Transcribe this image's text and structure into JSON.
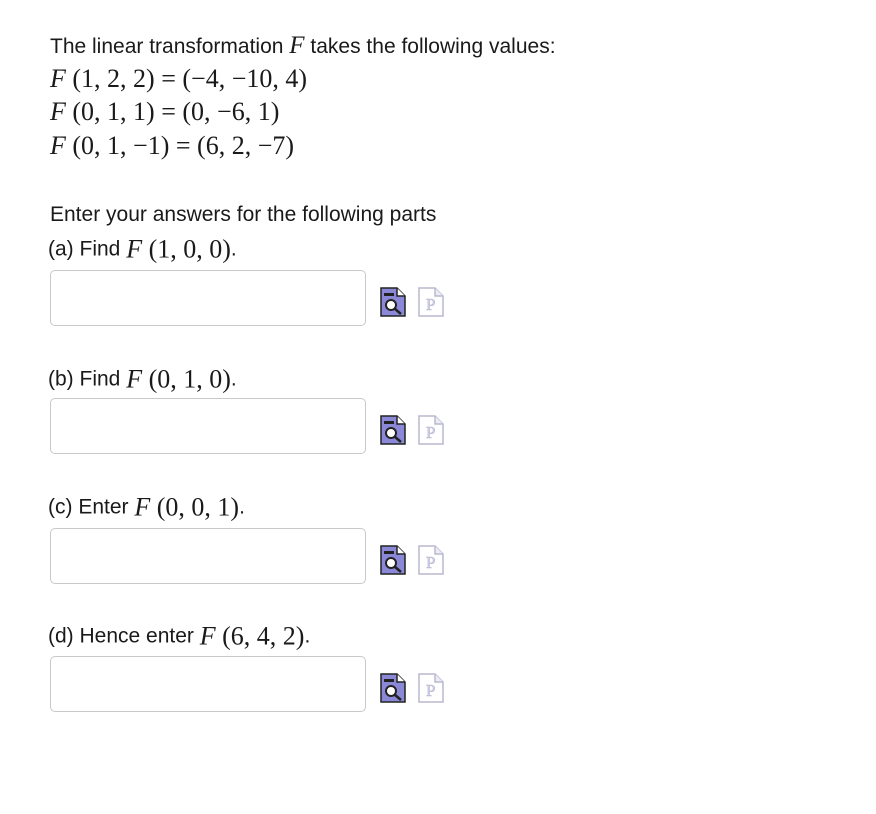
{
  "intro": {
    "text_before": "The linear transformation ",
    "symbol": "F",
    "text_after": " takes the following values:"
  },
  "given_values": [
    {
      "func": "F",
      "args": " (1, 2, 2) = (−4, −10, 4)"
    },
    {
      "func": "F",
      "args": " (0, 1, 1) = (0, −6, 1)"
    },
    {
      "func": "F",
      "args": " (0, 1, −1) = (6, 2, −7)"
    }
  ],
  "instructions": "Enter your answers for the following parts",
  "parts": [
    {
      "prefix": "(a) Find ",
      "func": "F",
      "args": " (1, 0, 0)",
      "suffix": ".",
      "value": "",
      "placeholder": ""
    },
    {
      "prefix": "(b) Find ",
      "func": "F",
      "args": " (0, 1, 0)",
      "suffix": ".",
      "value": "",
      "placeholder": ""
    },
    {
      "prefix": "(c) Enter ",
      "func": "F",
      "args": " (0, 0, 1)",
      "suffix": ".",
      "value": "",
      "placeholder": ""
    },
    {
      "prefix": "(d) Hence enter ",
      "func": "F",
      "args": " (6, 4, 2)",
      "suffix": ".",
      "value": "",
      "placeholder": ""
    }
  ],
  "icons": {
    "preview": "preview-magnifier-icon",
    "p_page": "p-page-icon",
    "preview_color": "#8c88d8",
    "p_color": "#cfcfe8"
  }
}
